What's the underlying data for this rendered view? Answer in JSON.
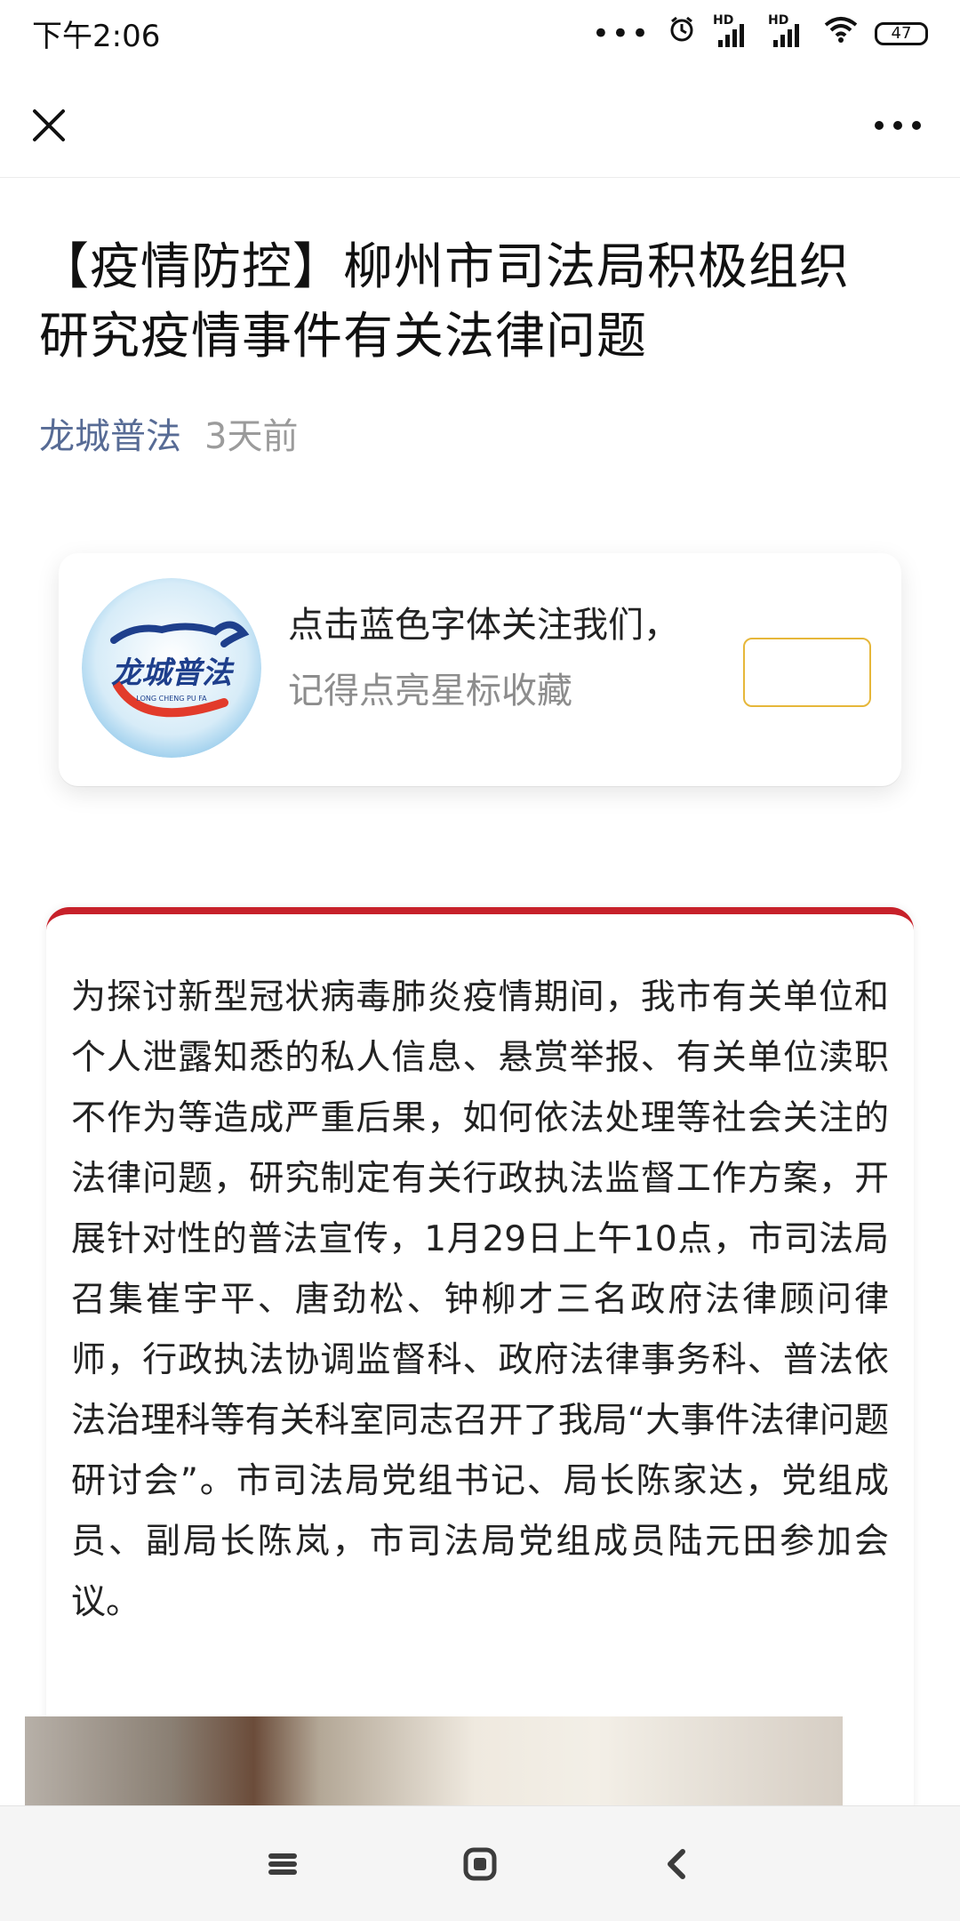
{
  "status_bar": {
    "time": "下午2:06",
    "battery": "47",
    "hd1": "HD",
    "hd2": "HD"
  },
  "header": {
    "close_icon": "close-icon",
    "more_icon": "more-icon"
  },
  "article": {
    "title_line1": "【疫情防控】柳州市司法局积极组织",
    "title_line2": "研究疫情事件有关法律问题",
    "author": "龙城普法",
    "time": "3天前",
    "body": "为探讨新型冠状病毒肺炎疫情期间，我市有关单位和个人泄露知悉的私人信息、悬赏举报、有关单位渎职不作为等造成严重后果，如何依法处理等社会关注的法律问题，研究制定有关行政执法监督工作方案，开展针对性的普法宣传，1月29日上午10点，市司法局召集崔宇平、唐劲松、钟柳才三名政府法律顾问律师，行政执法协调监督科、政府法律事务科、普法依法治理科等有关科室同志召开了我局“大事件法律问题研讨会”。市司法局党组书记、局长陈家达，党组成员、副局长陈岚，市司法局党组成员陆元田参加会议。"
  },
  "follow_card": {
    "line1": "点击蓝色字体关注我们，",
    "line2": "记得点亮星标收藏",
    "logo_text": "龙城普法",
    "logo_subtext": "LONG CHENG PU FA"
  },
  "colors": {
    "accent_red": "#c7212a",
    "link_blue": "#576b95",
    "button_gold": "#e6b73a"
  }
}
